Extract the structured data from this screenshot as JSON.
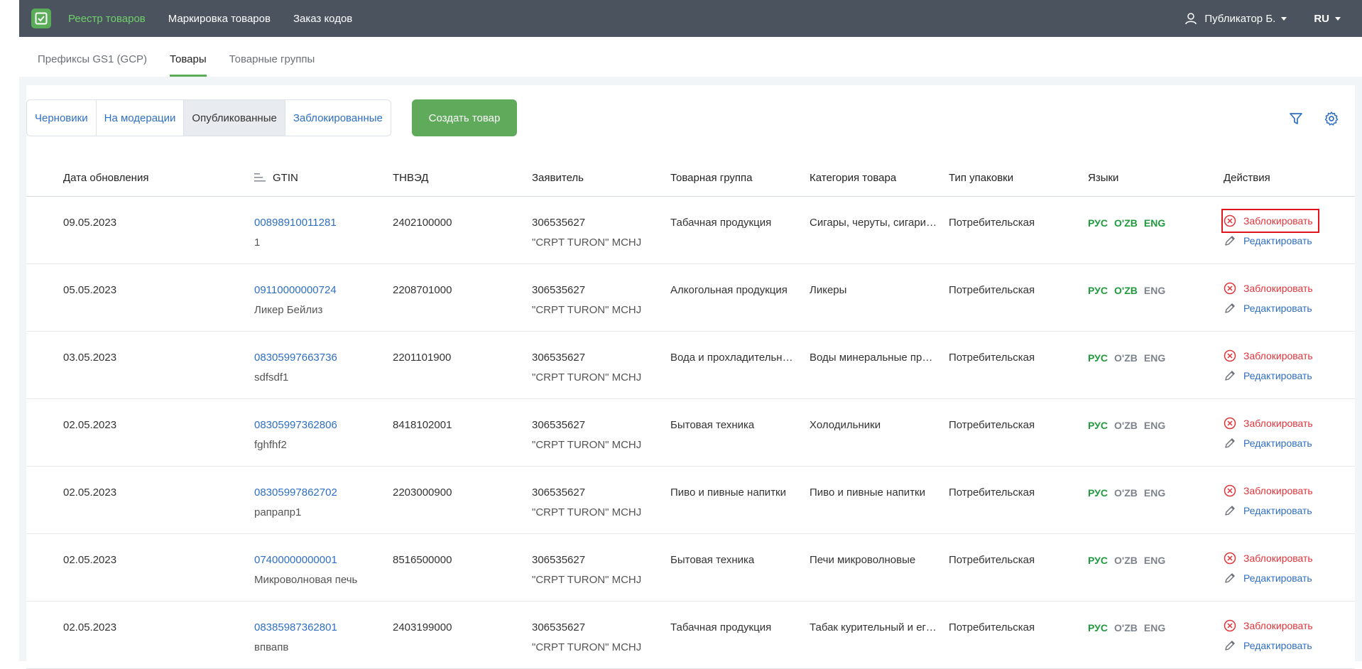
{
  "topbar": {
    "nav": [
      {
        "label": "Реестр товаров",
        "active": true
      },
      {
        "label": "Маркировка товаров",
        "active": false
      },
      {
        "label": "Заказ кодов",
        "active": false
      }
    ],
    "user": "Публикатор Б.",
    "lang": "RU",
    "icons": {
      "logo": "checklist-icon",
      "user": "user-icon",
      "dropdown": "caret-down-icon"
    }
  },
  "subnav": [
    {
      "label": "Префиксы GS1 (GCP)",
      "active": false
    },
    {
      "label": "Товары",
      "active": true
    },
    {
      "label": "Товарные группы",
      "active": false
    }
  ],
  "status_tabs": [
    {
      "label": "Черновики",
      "active": false
    },
    {
      "label": "На модерации",
      "active": false
    },
    {
      "label": "Опубликованные",
      "active": true
    },
    {
      "label": "Заблокированные",
      "active": false
    }
  ],
  "create_button": "Создать товар",
  "tools": {
    "filter": "filter-icon",
    "settings": "gear-icon"
  },
  "table": {
    "headers": [
      "Дата обновления",
      "GTIN",
      "ТНВЭД",
      "Заявитель",
      "Товарная группа",
      "Категория товара",
      "Тип упаковки",
      "Языки",
      "Действия"
    ],
    "sort_icon": "sort-icon",
    "languages": [
      "РУС",
      "O'ZB",
      "ENG"
    ],
    "actions": {
      "block": "Заблокировать",
      "edit": "Редактировать"
    },
    "rows": [
      {
        "date": "09.05.2023",
        "gtin": "00898910011281",
        "name": "1",
        "tnved": "2402100000",
        "applicant_id": "306535627",
        "applicant_name": "\"CRPT TURON\" MCHJ",
        "group": "Табачная продукция",
        "category": "Сигары, черуты, сигариллы",
        "package": "Потребительская",
        "lang_active": [
          true,
          true,
          true
        ]
      },
      {
        "date": "05.05.2023",
        "gtin": "09110000000724",
        "name": "Ликер Бейлиз",
        "tnved": "2208701000",
        "applicant_id": "306535627",
        "applicant_name": "\"CRPT TURON\" MCHJ",
        "group": "Алкогольная продукция",
        "category": "Ликеры",
        "package": "Потребительская",
        "lang_active": [
          true,
          true,
          false
        ]
      },
      {
        "date": "03.05.2023",
        "gtin": "08305997663736",
        "name": "sdfsdf1",
        "tnved": "2201101900",
        "applicant_id": "306535627",
        "applicant_name": "\"CRPT TURON\" MCHJ",
        "group": "Вода и прохладительные напитки",
        "category": "Воды минеральные природные",
        "package": "Потребительская",
        "lang_active": [
          true,
          false,
          false
        ]
      },
      {
        "date": "02.05.2023",
        "gtin": "08305997362806",
        "name": "fghfhf2",
        "tnved": "8418102001",
        "applicant_id": "306535627",
        "applicant_name": "\"CRPT TURON\" MCHJ",
        "group": "Бытовая техника",
        "category": "Холодильники",
        "package": "Потребительская",
        "lang_active": [
          true,
          false,
          false
        ]
      },
      {
        "date": "02.05.2023",
        "gtin": "08305997862702",
        "name": "рапрапр1",
        "tnved": "2203000900",
        "applicant_id": "306535627",
        "applicant_name": "\"CRPT TURON\" MCHJ",
        "group": "Пиво и пивные напитки",
        "category": "Пиво и пивные напитки",
        "package": "Потребительская",
        "lang_active": [
          true,
          false,
          false
        ]
      },
      {
        "date": "02.05.2023",
        "gtin": "07400000000001",
        "name": "Микроволновая печь",
        "tnved": "8516500000",
        "applicant_id": "306535627",
        "applicant_name": "\"CRPT TURON\" MCHJ",
        "group": "Бытовая техника",
        "category": "Печи микроволновые",
        "package": "Потребительская",
        "lang_active": [
          true,
          false,
          false
        ]
      },
      {
        "date": "02.05.2023",
        "gtin": "08385987362801",
        "name": "впвапв",
        "tnved": "2403199000",
        "applicant_id": "306535627",
        "applicant_name": "\"CRPT TURON\" MCHJ",
        "group": "Табачная продукция",
        "category": "Табак курительный и его заменители",
        "package": "Потребительская",
        "lang_active": [
          true,
          false,
          false
        ]
      }
    ]
  }
}
